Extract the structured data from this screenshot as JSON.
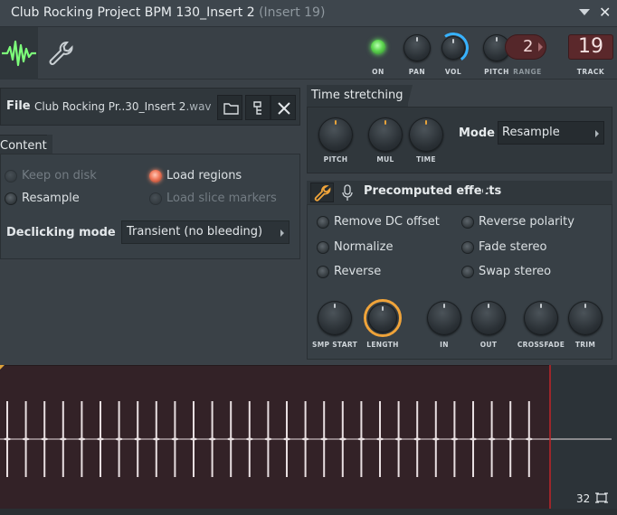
{
  "window": {
    "title": "Club Rocking Project BPM 130_Insert 2",
    "subtitle": "(Insert 19)"
  },
  "toolbar": {
    "on_label": "ON",
    "pan_label": "PAN",
    "vol_label": "VOL",
    "pitch_label": "PITCH",
    "range_label": "RANGE",
    "range_value": "2",
    "track_label": "TRACK",
    "track_value": "19",
    "colors": {
      "on_led": "#5ed650",
      "vol_ring": "#37b2ff",
      "track_box": "#5b282b"
    }
  },
  "file": {
    "label": "File",
    "name": "Club Rocking Pr..30_Insert 2",
    "ext": ".wav"
  },
  "content": {
    "tab_label": "Content",
    "options": {
      "keep_on_disk": "Keep on disk",
      "resample": "Resample",
      "load_regions": "Load regions",
      "load_slice_markers": "Load slice markers"
    },
    "declicking_label": "Declicking mode",
    "declicking_value": "Transient (no bleeding)"
  },
  "time_stretching": {
    "tab_label": "Time stretching",
    "knobs": {
      "pitch": "PITCH",
      "mul": "MUL",
      "time": "TIME"
    },
    "mode_label": "Mode",
    "mode_value": "Resample"
  },
  "precomputed": {
    "title": "Precomputed effects",
    "options": {
      "remove_dc": "Remove DC offset",
      "reverse_polarity": "Reverse polarity",
      "normalize": "Normalize",
      "fade_stereo": "Fade stereo",
      "reverse": "Reverse",
      "swap_stereo": "Swap stereo"
    },
    "knobs": {
      "smp_start": "SMP START",
      "length": "LENGTH",
      "in": "IN",
      "out": "OUT",
      "crossfade": "CROSSFADE",
      "trim": "TRIM"
    },
    "colors": {
      "length_ring": "#f0a43a"
    }
  },
  "waveform": {
    "count": "32",
    "colors": {
      "background": "#332227",
      "marker": "#c0282c",
      "wave": "#e8dfe1"
    }
  }
}
